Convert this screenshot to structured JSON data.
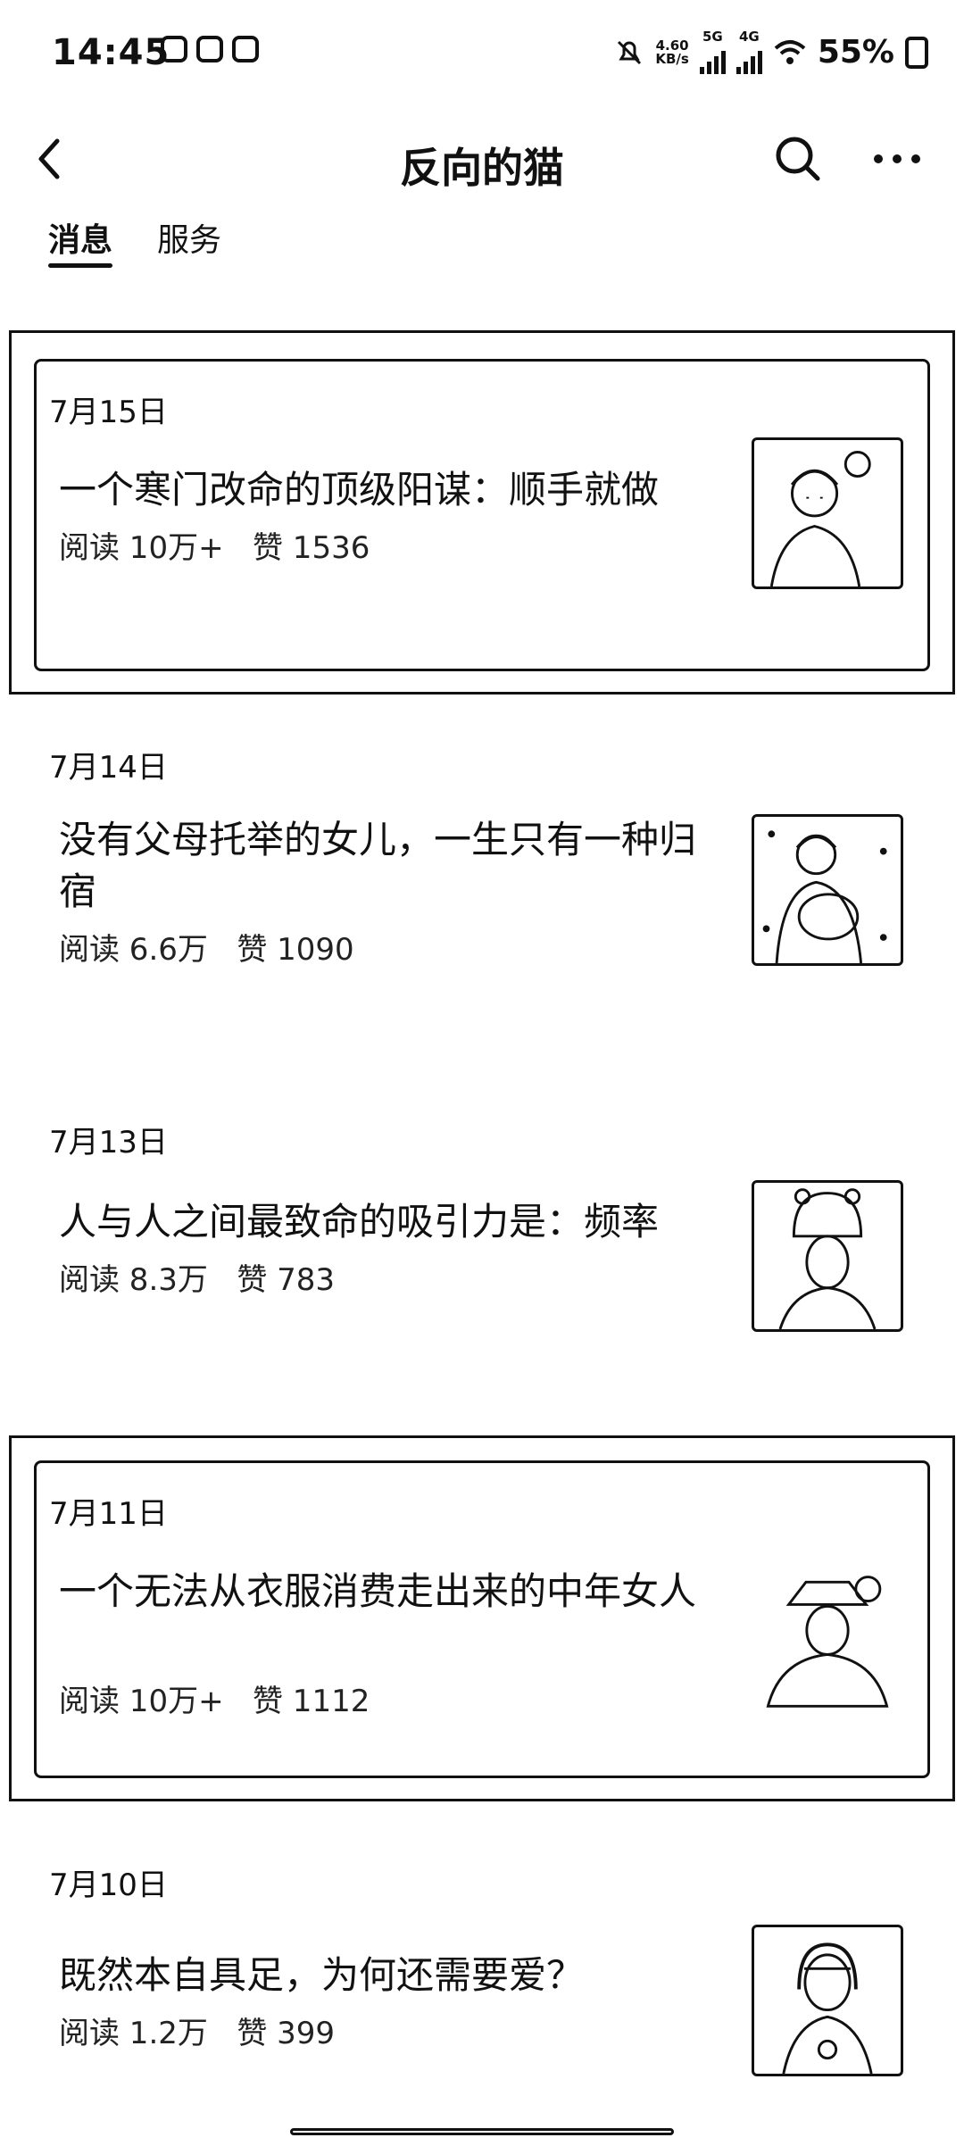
{
  "status_bar": {
    "time": "14:45",
    "net_speed_top": "4.60",
    "net_speed_bottom": "KB/s",
    "sim1": "5G",
    "sim2": "4G",
    "battery_percent": "55%"
  },
  "header": {
    "title": "反向的猫",
    "icons": {
      "back": "chevron-left-icon",
      "search": "search-icon",
      "more": "more-icon"
    }
  },
  "tabs": [
    {
      "label": "消息",
      "active": true
    },
    {
      "label": "服务",
      "active": false
    }
  ],
  "feed": [
    {
      "date": "7月15日",
      "title": "一个寒门改命的顶级阳谋：顺手就做",
      "reads": "阅读 10万+",
      "likes": "赞 1536",
      "highlighted": true,
      "thumbnail": "woman-portrait-thumbnail"
    },
    {
      "date": "7月14日",
      "title": "没有父母托举的女儿，一生只有一种归宿",
      "reads": "阅读 6.6万",
      "likes": "赞 1090",
      "highlighted": false,
      "thumbnail": "woman-holding-child-thumbnail"
    },
    {
      "date": "7月13日",
      "title": "人与人之间最致命的吸引力是：频率",
      "reads": "阅读 8.3万",
      "likes": "赞 783",
      "highlighted": false,
      "thumbnail": "woman-with-bear-hat-thumbnail"
    },
    {
      "date": "7月11日",
      "title": "一个无法从衣服消费走出来的中年女人",
      "reads": "阅读 10万+",
      "likes": "赞 1112",
      "highlighted": true,
      "thumbnail": "woman-with-hat-thumbnail"
    },
    {
      "date": "7月10日",
      "title": "既然本自具足，为何还需要爱？",
      "reads": "阅读 1.2万",
      "likes": "赞 399",
      "highlighted": false,
      "thumbnail": "girl-portrait-thumbnail"
    }
  ]
}
